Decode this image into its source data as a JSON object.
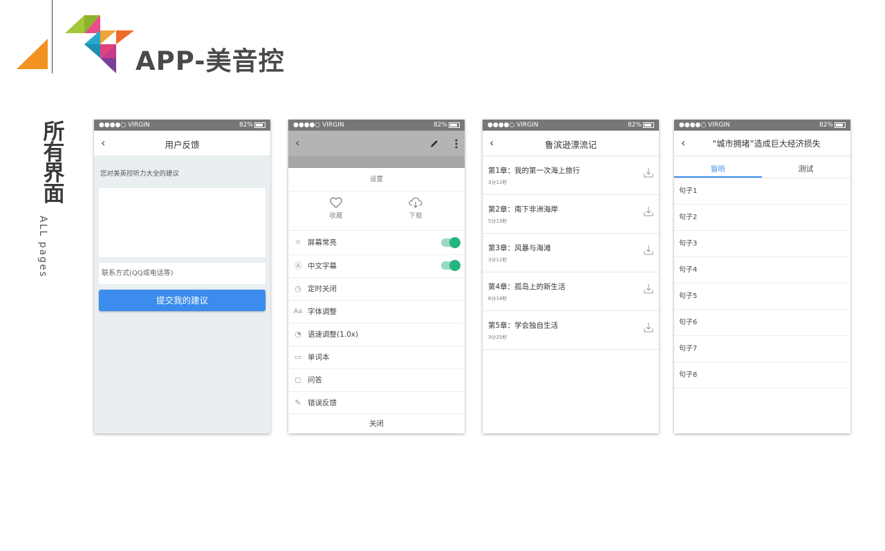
{
  "header": {
    "title": "APP-美音控"
  },
  "side": {
    "title": "所有界面",
    "subtitle": "ALL pages"
  },
  "status": {
    "carrier": "●●●●○ VIRGIN",
    "battery": "82%"
  },
  "feedback": {
    "title": "用户反馈",
    "prompt": "您对美英控听力大全的建议",
    "contact_placeholder": "联系方式(QQ或电话等)",
    "submit": "提交我的建议"
  },
  "settings": {
    "header": "设置",
    "actions": [
      {
        "label": "收藏",
        "icon": "heart-icon"
      },
      {
        "label": "下载",
        "icon": "cloud-download-icon"
      }
    ],
    "rows": [
      {
        "label": "屏幕常亮",
        "icon": "sun-icon",
        "toggle": true
      },
      {
        "label": "中文字幕",
        "icon": "subtitle-icon",
        "toggle": true
      },
      {
        "label": "定时关闭",
        "icon": "clock-icon",
        "toggle": false
      },
      {
        "label": "字体调整",
        "icon": "font-icon",
        "toggle": false
      },
      {
        "label": "语速调整(1.0x)",
        "icon": "speed-icon",
        "toggle": false
      },
      {
        "label": "单词本",
        "icon": "notebook-icon",
        "toggle": false
      },
      {
        "label": "问答",
        "icon": "qa-icon",
        "toggle": false
      },
      {
        "label": "错误反馈",
        "icon": "report-icon",
        "toggle": false
      }
    ],
    "close": "关闭"
  },
  "chapters": {
    "title": "鲁滨逊漂流记",
    "items": [
      {
        "title": "第1章：我的第一次海上旅行",
        "duration": "3分11秒"
      },
      {
        "title": "第2章：南下非洲海岸",
        "duration": "5分15秒"
      },
      {
        "title": "第3章：风暴与海滩",
        "duration": "3分11秒"
      },
      {
        "title": "第4章：孤岛上的新生活",
        "duration": "6分18秒"
      },
      {
        "title": "第5章：学会独自生活",
        "duration": "3分25秒"
      }
    ]
  },
  "sentences": {
    "title": "“城市拥堵”造成巨大经济损失",
    "tabs": [
      "盲听",
      "测试"
    ],
    "items": [
      "句子1",
      "句子2",
      "句子3",
      "句子4",
      "句子5",
      "句子6",
      "句子7",
      "句子8"
    ]
  },
  "colors": {
    "accent": "#3b8ced",
    "toggle": "#25b57e",
    "status_bar": "#777777"
  }
}
